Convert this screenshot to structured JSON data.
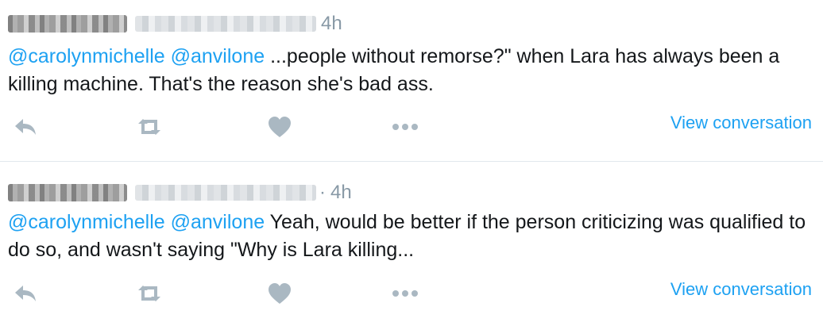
{
  "tweets": [
    {
      "time": "4h",
      "mentions": [
        "@carolynmichelle",
        "@anvilone"
      ],
      "text": " ...people without remorse?\" when Lara has always been a killing machine.  That's the reason she's bad ass.",
      "view_conversation": "View conversation"
    },
    {
      "separator": "·",
      "time": "4h",
      "mentions": [
        "@carolynmichelle",
        "@anvilone"
      ],
      "text": " Yeah, would be better if the person criticizing was qualified to do so, and wasn't saying \"Why is Lara killing...",
      "view_conversation": "View conversation"
    }
  ],
  "icons": {
    "reply": "reply-icon",
    "retweet": "retweet-icon",
    "like": "heart-icon",
    "more": "more-dots-icon"
  },
  "colors": {
    "mention": "#1da1f2",
    "meta": "#8899a6",
    "action_icon": "#aab8c2",
    "text": "#14171a"
  }
}
